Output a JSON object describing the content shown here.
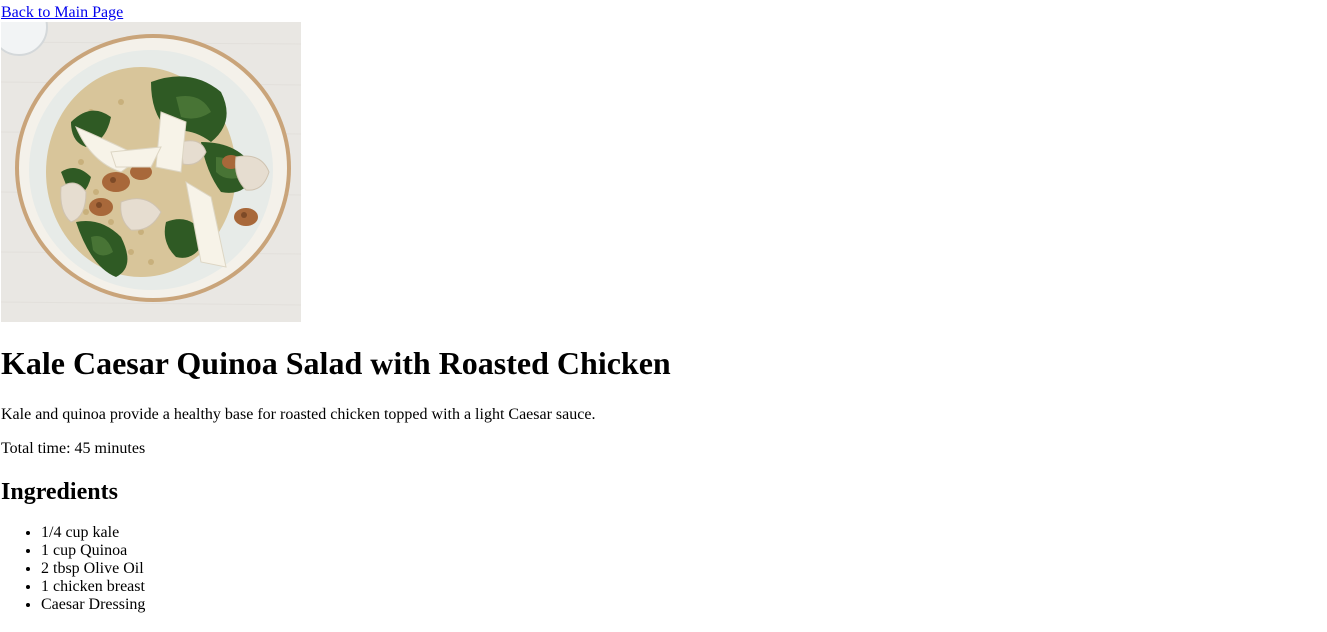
{
  "nav": {
    "back_label": "Back to Main Page"
  },
  "recipe": {
    "title": "Kale Caesar Quinoa Salad with Roasted Chicken",
    "description": "Kale and quinoa provide a healthy base for roasted chicken topped with a light Caesar sauce.",
    "total_time": "Total time: 45 minutes",
    "ingredients_heading": "Ingredients",
    "ingredients": [
      "1/4 cup kale",
      "1 cup Quinoa",
      "2 tbsp Olive Oil",
      "1 chicken breast",
      "Caesar Dressing"
    ]
  },
  "colors": {
    "link": "#0000ee",
    "text": "#000000",
    "background": "#ffffff"
  }
}
